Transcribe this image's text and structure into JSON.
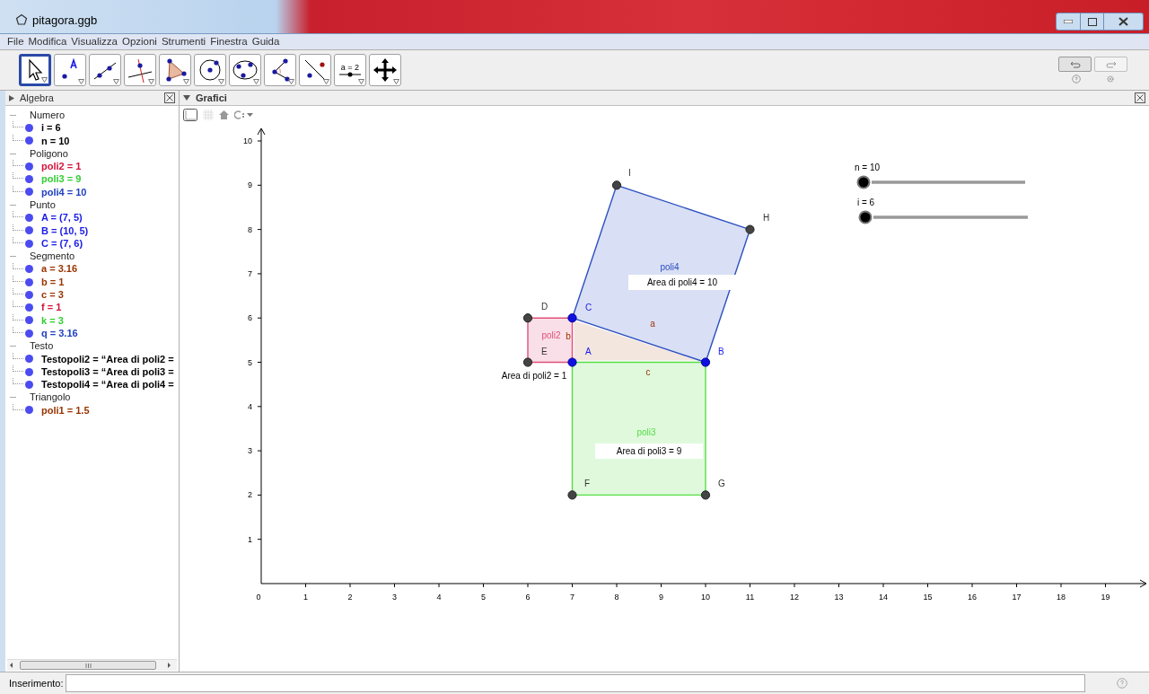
{
  "window": {
    "title": "pitagora.ggb"
  },
  "menu": [
    "File",
    "Modifica",
    "Visualizza",
    "Opzioni",
    "Strumenti",
    "Finestra",
    "Guida"
  ],
  "toolbar": [
    {
      "kind": "move",
      "selected": true
    },
    {
      "kind": "point",
      "selected": false
    },
    {
      "kind": "line",
      "selected": false
    },
    {
      "kind": "perpendicular",
      "selected": false
    },
    {
      "kind": "polygon",
      "selected": false
    },
    {
      "kind": "circle",
      "selected": false
    },
    {
      "kind": "conic",
      "selected": false
    },
    {
      "kind": "angle",
      "selected": false
    },
    {
      "kind": "reflect",
      "selected": false
    },
    {
      "kind": "slider",
      "selected": false,
      "label": "a = 2"
    },
    {
      "kind": "pan",
      "selected": false
    }
  ],
  "algebra": {
    "title": "Algebra",
    "groups": [
      {
        "name": "Numero",
        "expanded": true,
        "items": [
          {
            "text": "i = 6",
            "color": "#000000"
          },
          {
            "text": "n = 10",
            "color": "#000000"
          }
        ]
      },
      {
        "name": "Poligono",
        "expanded": true,
        "items": [
          {
            "text": "poli2 = 1",
            "color": "#d4143c"
          },
          {
            "text": "poli3 = 9",
            "color": "#33cc33"
          },
          {
            "text": "poli4 = 10",
            "color": "#2040c0"
          }
        ]
      },
      {
        "name": "Punto",
        "expanded": true,
        "items": [
          {
            "text": "A = (7, 5)",
            "color": "#1a1ae6"
          },
          {
            "text": "B = (10, 5)",
            "color": "#1a1ae6"
          },
          {
            "text": "C = (7, 6)",
            "color": "#1a1ae6"
          }
        ]
      },
      {
        "name": "Segmento",
        "expanded": true,
        "items": [
          {
            "text": "a = 3.16",
            "color": "#993300"
          },
          {
            "text": "b = 1",
            "color": "#993300"
          },
          {
            "text": "c = 3",
            "color": "#993300"
          },
          {
            "text": "f = 1",
            "color": "#d4143c"
          },
          {
            "text": "k = 3",
            "color": "#33cc33"
          },
          {
            "text": "q = 3.16",
            "color": "#2040c0"
          }
        ]
      },
      {
        "name": "Testo",
        "expanded": true,
        "items": [
          {
            "text": "Testopoli2 = “Area di poli2 =",
            "color": "#000000"
          },
          {
            "text": "Testopoli3 = “Area di poli3 =",
            "color": "#000000"
          },
          {
            "text": "Testopoli4 = “Area di poli4 =",
            "color": "#000000"
          }
        ]
      },
      {
        "name": "Triangolo",
        "expanded": true,
        "items": [
          {
            "text": "poli1 = 1.5",
            "color": "#993300"
          }
        ]
      }
    ]
  },
  "graphics": {
    "title": "Grafici",
    "x_ticks": [
      "0",
      "1",
      "2",
      "3",
      "4",
      "5",
      "6",
      "7",
      "8",
      "9",
      "10",
      "11",
      "12",
      "13",
      "14",
      "15",
      "16",
      "17",
      "18",
      "19"
    ],
    "y_ticks": [
      "10",
      "9",
      "8",
      "7",
      "6",
      "5",
      "4",
      "3",
      "2",
      "1"
    ],
    "polygons": [
      {
        "label": "poli4",
        "color": "#2c4fc0"
      },
      {
        "label": "poli2",
        "color": "#e0507a"
      },
      {
        "label": "poli3",
        "color": "#55dd44"
      }
    ],
    "segment_labels": [
      "a",
      "b",
      "c"
    ],
    "points": [
      {
        "label": "I",
        "kind": "dependent"
      },
      {
        "label": "H",
        "kind": "dependent"
      },
      {
        "label": "D",
        "kind": "dependent"
      },
      {
        "label": "C",
        "kind": "free"
      },
      {
        "label": "E",
        "kind": "dependent"
      },
      {
        "label": "A",
        "kind": "free"
      },
      {
        "label": "B",
        "kind": "free"
      },
      {
        "label": "F",
        "kind": "dependent"
      },
      {
        "label": "G",
        "kind": "dependent"
      }
    ],
    "area_texts": [
      "Area di poli4 = 10",
      "Area di poli2 = 1",
      "Area di poli3 = 9"
    ],
    "sliders": [
      {
        "label": "n = 10",
        "level": 0
      },
      {
        "label": "i = 6",
        "level": 0
      }
    ]
  },
  "input_bar": {
    "label": "Inserimento:"
  }
}
